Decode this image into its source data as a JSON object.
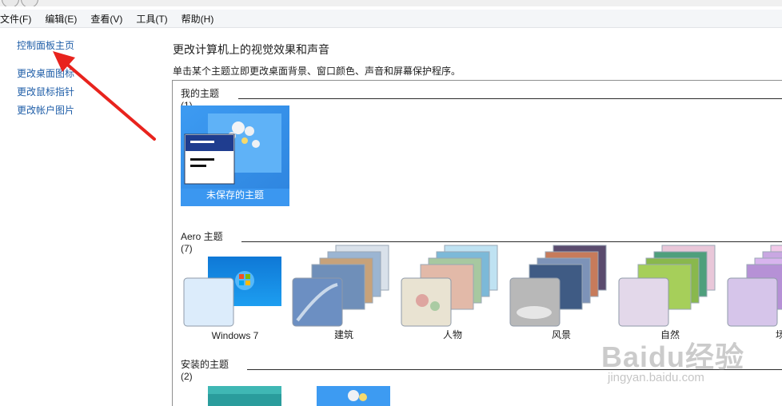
{
  "menubar": {
    "items": [
      "文件(F)",
      "编辑(E)",
      "查看(V)",
      "工具(T)",
      "帮助(H)"
    ]
  },
  "sidebar": {
    "home_link": "控制面板主页",
    "links": [
      "更改桌面图标",
      "更改鼠标指针",
      "更改帐户图片"
    ]
  },
  "main": {
    "heading": "更改计算机上的视觉效果和声音",
    "subheading": "单击某个主题立即更改桌面背景、窗口颜色、声音和屏幕保护程序。",
    "my_themes": {
      "header": "我的主题 (1)",
      "items": [
        {
          "label": "未保存的主题",
          "selected": true
        }
      ]
    },
    "aero_themes": {
      "header": "Aero 主题 (7)",
      "items": [
        {
          "label": "Windows 7"
        },
        {
          "label": "建筑"
        },
        {
          "label": "人物"
        },
        {
          "label": "风景"
        },
        {
          "label": "自然"
        },
        {
          "label": "场景"
        }
      ]
    },
    "installed_themes": {
      "header": "安装的主题 (2)"
    }
  },
  "watermark": {
    "brand": "Baidu经验",
    "url": "jingyan.baidu.com"
  },
  "colors": {
    "link": "#1f5ea8",
    "selection": "#3b97f0",
    "annotation_arrow": "#e8231d"
  }
}
